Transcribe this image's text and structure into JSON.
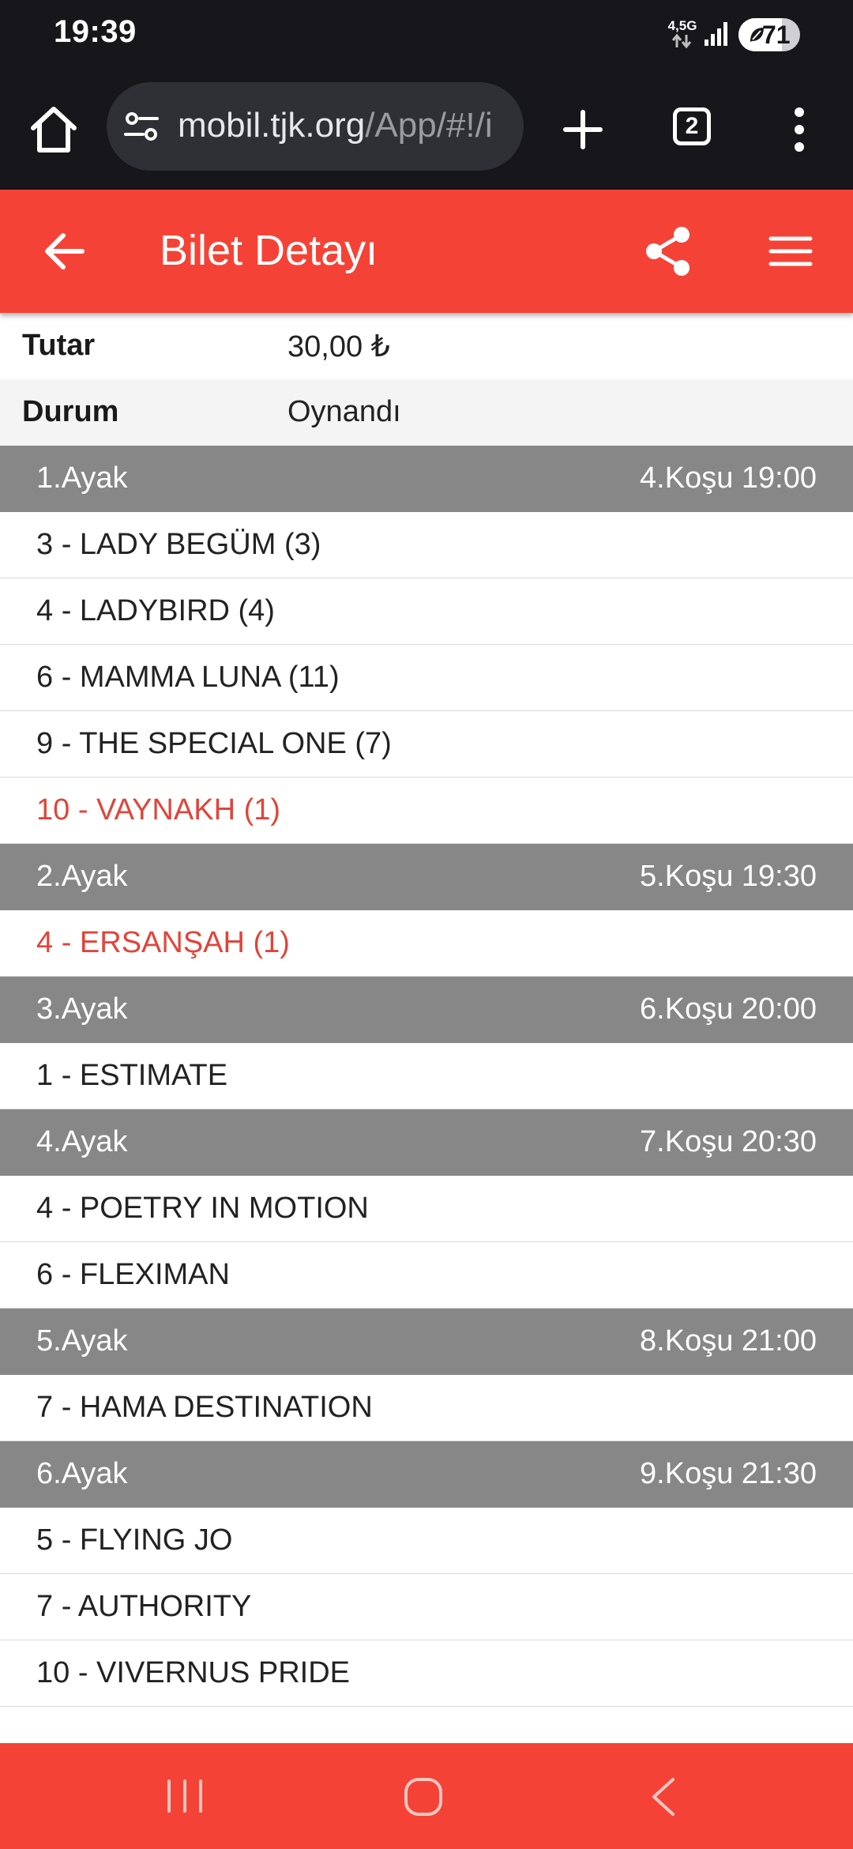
{
  "status_bar": {
    "time": "19:39",
    "network": "4,5G",
    "battery_percent": 71,
    "battery_label": "71",
    "icons": [
      "signal-icon",
      "battery-icon"
    ]
  },
  "browser": {
    "url_main": "mobil.tjk.org",
    "url_path": "/App/#!/i",
    "tab_count": "2",
    "icons": [
      "home-icon",
      "site-info-icon",
      "new-tab-icon",
      "tabs-icon",
      "more-vert-icon"
    ]
  },
  "header": {
    "title": "Bilet Detayı",
    "icons": [
      "back-arrow-icon",
      "share-icon",
      "hamburger-menu-icon"
    ]
  },
  "details": [
    {
      "label": "Tutar",
      "value": "30,00 ₺"
    },
    {
      "label": "Durum",
      "value": "Oynandı"
    }
  ],
  "legs": [
    {
      "name": "1.Ayak",
      "race": "4.Koşu 19:00",
      "horses": [
        {
          "text": "3 - LADY BEGÜM (3)",
          "winner": false
        },
        {
          "text": "4 - LADYBIRD (4)",
          "winner": false
        },
        {
          "text": "6 - MAMMA LUNA (11)",
          "winner": false
        },
        {
          "text": "9 - THE SPECIAL ONE (7)",
          "winner": false
        },
        {
          "text": "10 - VAYNAKH (1)",
          "winner": true
        }
      ]
    },
    {
      "name": "2.Ayak",
      "race": "5.Koşu 19:30",
      "horses": [
        {
          "text": "4 - ERSANŞAH (1)",
          "winner": true
        }
      ]
    },
    {
      "name": "3.Ayak",
      "race": "6.Koşu 20:00",
      "horses": [
        {
          "text": "1 - ESTIMATE",
          "winner": false
        }
      ]
    },
    {
      "name": "4.Ayak",
      "race": "7.Koşu 20:30",
      "horses": [
        {
          "text": "4 - POETRY IN MOTION",
          "winner": false
        },
        {
          "text": "6 - FLEXIMAN",
          "winner": false
        }
      ]
    },
    {
      "name": "5.Ayak",
      "race": "8.Koşu 21:00",
      "horses": [
        {
          "text": "7 - HAMA DESTINATION",
          "winner": false
        }
      ]
    },
    {
      "name": "6.Ayak",
      "race": "9.Koşu 21:30",
      "horses": [
        {
          "text": "5 - FLYING JO",
          "winner": false
        },
        {
          "text": "7 - AUTHORITY",
          "winner": false
        },
        {
          "text": "10 - VIVERNUS PRIDE",
          "winner": false
        }
      ]
    }
  ],
  "nav_bar": {
    "icons": [
      "recents-icon",
      "home-icon",
      "back-icon"
    ]
  },
  "colors": {
    "accent": "#f44336",
    "winner_text": "#e0453a",
    "leg_header_bg": "#878787",
    "system_bar_bg": "#16161b"
  }
}
